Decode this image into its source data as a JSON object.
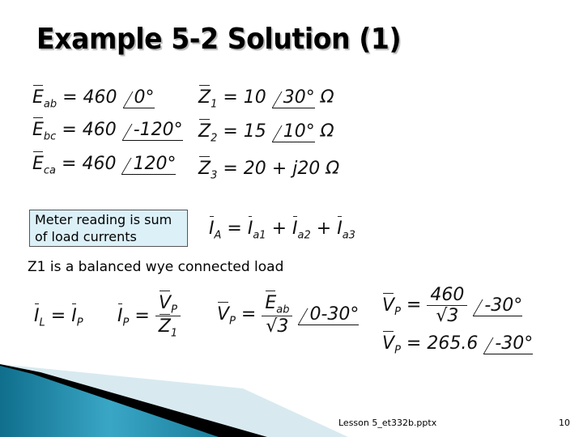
{
  "slide": {
    "title": "Example 5-2 Solution (1)",
    "source_equations": [
      {
        "sym": "E",
        "sub": "ab",
        "rhs": "= 460",
        "angle": "0°"
      },
      {
        "sym": "E",
        "sub": "bc",
        "rhs": "= 460",
        "angle": "-120°"
      },
      {
        "sym": "E",
        "sub": "ca",
        "rhs": "= 460",
        "angle": "120°"
      }
    ],
    "load_equations": [
      {
        "sym": "Z",
        "sub": "1",
        "rhs": "= 10",
        "angle": "30°",
        "unit": "Ω"
      },
      {
        "sym": "Z",
        "sub": "2",
        "rhs": "= 15",
        "angle": "10°",
        "unit": "Ω"
      },
      {
        "sym": "Z",
        "sub": "3",
        "rhs": "= 20 + j20",
        "angle": "",
        "unit": "Ω"
      }
    ],
    "meter_note": {
      "line1": "Meter reading is sum",
      "line2": "of load currents"
    },
    "sum_equation": {
      "lhs_sym": "I",
      "lhs_sub": "A",
      "eq": "=",
      "terms": [
        {
          "sym": "I",
          "sub": "a1"
        },
        {
          "sym": "I",
          "sub": "a2"
        },
        {
          "sym": "I",
          "sub": "a3"
        }
      ],
      "plus": "+"
    },
    "wye_note": "Z1 is a balanced wye connected load",
    "wye_equations": {
      "il_eq_ip": {
        "l_sym": "I",
        "l_sub": "L",
        "eq": "=",
        "r_sym": "I",
        "r_sub": "P"
      },
      "ip_eq": {
        "sym": "I",
        "sub": "P",
        "eq": "=",
        "num_sym": "V",
        "num_sub": "P",
        "den_sym": "Z",
        "den_sub": "1"
      },
      "vp_eq": {
        "sym": "V",
        "sub": "P",
        "eq": "=",
        "num_sym": "E",
        "num_sub": "ab",
        "den": "√3",
        "angle": "0-30°"
      },
      "vp_value1": {
        "sym": "V",
        "sub": "P",
        "eq": "=",
        "num": "460",
        "den": "√3",
        "angle": "-30°"
      },
      "vp_value2": {
        "sym": "V",
        "sub": "P",
        "eq": "=",
        "value": "265.6",
        "angle": "-30°"
      }
    },
    "footer": {
      "filename": "Lesson 5_et332b.pptx",
      "page_number": "10"
    }
  }
}
